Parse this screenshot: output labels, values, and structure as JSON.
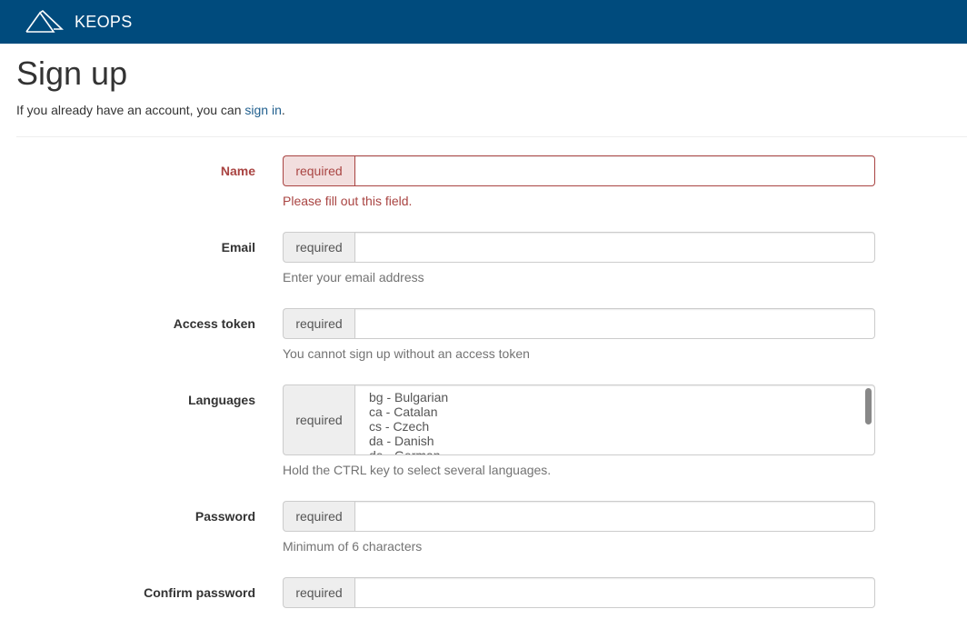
{
  "navbar": {
    "brand": "KEOPS",
    "logo_icon": "mountains-icon"
  },
  "page": {
    "title": "Sign up",
    "lead_prefix": "If you already have an account, you can ",
    "lead_link": "sign in",
    "lead_suffix": "."
  },
  "form": {
    "fields": [
      {
        "label": "Name",
        "addon": "required",
        "value": "",
        "help": "Please fill out this field.",
        "state": "error"
      },
      {
        "label": "Email",
        "addon": "required",
        "value": "",
        "help": "Enter your email address"
      },
      {
        "label": "Access token",
        "addon": "required",
        "value": "",
        "help": "You cannot sign up without an access token"
      },
      {
        "label": "Languages",
        "addon": "required",
        "help": "Hold the CTRL key to select several languages.",
        "options": [
          "bg - Bulgarian",
          "ca - Catalan",
          "cs - Czech",
          "da - Danish",
          "de - German"
        ]
      },
      {
        "label": "Password",
        "addon": "required",
        "value": "",
        "help": "Minimum of 6 characters"
      },
      {
        "label": "Confirm password",
        "addon": "required",
        "value": ""
      }
    ]
  },
  "colors": {
    "navbar": "#004b7d",
    "error": "#a94442",
    "link": "#1f5e8d"
  }
}
